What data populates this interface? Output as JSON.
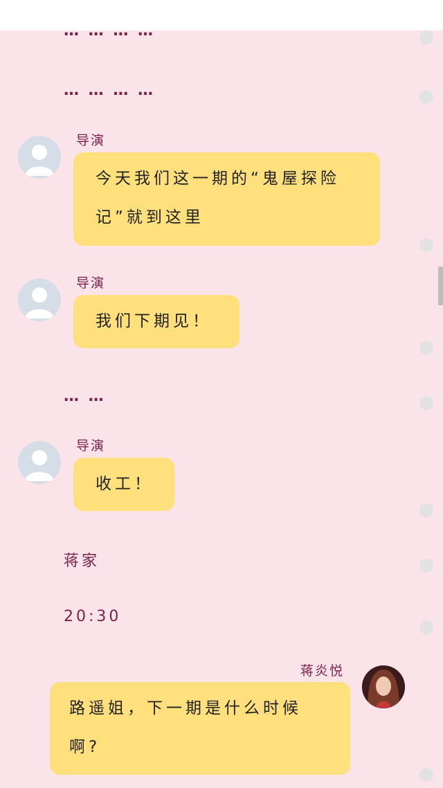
{
  "colors": {
    "background": "#fbe3ea",
    "bubble": "#ffe07d",
    "narration_text": "#7a1f4a",
    "avatar_placeholder": "#d5dde6"
  },
  "narration": {
    "ellipsis_1": "… … … …",
    "ellipsis_2": "… … … …",
    "ellipsis_3": "… …",
    "scene": "蒋家",
    "time": "20:30"
  },
  "messages": [
    {
      "sender": "导演",
      "text_line1": "今天我们这一期的“鬼屋探险",
      "text_line2": "记”就到这里",
      "avatar": "default-avatar-icon"
    },
    {
      "sender": "导演",
      "text": "我们下期见！",
      "avatar": "default-avatar-icon"
    },
    {
      "sender": "导演",
      "text": "收工！",
      "avatar": "default-avatar-icon"
    },
    {
      "sender": "蒋炎悦",
      "text_line1": "路遥姐，下一期是什么时候",
      "text_line2": "啊?",
      "avatar": "user-photo-avatar"
    }
  ]
}
